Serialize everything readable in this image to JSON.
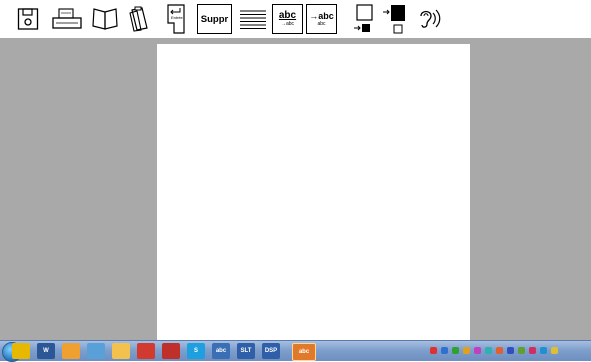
{
  "toolbar": {
    "tools": [
      {
        "name": "save-icon",
        "label": ""
      },
      {
        "name": "print-icon",
        "label": ""
      },
      {
        "name": "open-book-icon",
        "label": ""
      },
      {
        "name": "clipboard-icon",
        "label": ""
      },
      {
        "name": "enter-key-icon",
        "label": "Entrée"
      },
      {
        "name": "delete-button",
        "label": "Suppr"
      },
      {
        "name": "justify-lines-icon",
        "label": ""
      },
      {
        "name": "text-size-small-icon",
        "label": "abc",
        "sub": "→abc"
      },
      {
        "name": "text-size-large-icon",
        "label": "→abc",
        "sub": "abc"
      },
      {
        "name": "white-to-black-icon",
        "label": ""
      },
      {
        "name": "black-to-white-icon",
        "label": ""
      },
      {
        "name": "speech-ear-icon",
        "label": ""
      }
    ]
  },
  "taskbar": {
    "apps": [
      {
        "name": "chrome-icon",
        "color": "#e8b800"
      },
      {
        "name": "word-icon",
        "color": "#2b5797",
        "label": "W"
      },
      {
        "name": "paint-icon",
        "color": "#f0a030"
      },
      {
        "name": "network-icon",
        "color": "#5aa0d8"
      },
      {
        "name": "folder-icon",
        "color": "#f2c14e"
      },
      {
        "name": "app-red-icon",
        "color": "#d33a2f"
      },
      {
        "name": "app-red2-icon",
        "color": "#c0302a"
      },
      {
        "name": "skype-icon",
        "color": "#1ea0e0",
        "label": "S"
      },
      {
        "name": "abc-app-icon",
        "color": "#3a6fb5",
        "label": "abc"
      },
      {
        "name": "slt-app-icon",
        "color": "#2f5fa8",
        "label": "SLT"
      },
      {
        "name": "dsp-app-icon",
        "color": "#2f5fa8",
        "label": "DSP"
      },
      {
        "name": "abc-active-icon",
        "color": "#e07a2a",
        "label": "abc"
      }
    ],
    "tray_colors": [
      "#e03030",
      "#3070d0",
      "#30a030",
      "#e0a020",
      "#c040c0",
      "#30b0b0",
      "#e06030",
      "#3050c0",
      "#60a030",
      "#d03060",
      "#2090d0",
      "#e0c030"
    ]
  },
  "colors": {
    "workspace": "#a9a9a9",
    "page": "#ffffff",
    "toolbar": "#ffffff"
  }
}
